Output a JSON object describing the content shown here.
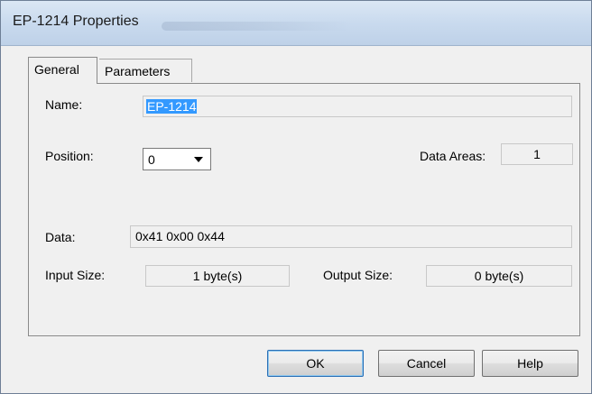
{
  "window": {
    "title": "EP-1214 Properties"
  },
  "tabs": [
    {
      "label": "General",
      "active": true
    },
    {
      "label": "Parameters",
      "active": false
    }
  ],
  "general": {
    "name_label": "Name:",
    "name_value": "EP-1214",
    "position_label": "Position:",
    "position_value": "0",
    "data_areas_label": "Data Areas:",
    "data_areas_value": "1",
    "data_label": "Data:",
    "data_value": "0x41 0x00 0x44",
    "input_size_label": "Input Size:",
    "input_size_value": "1 byte(s)",
    "output_size_label": "Output Size:",
    "output_size_value": "0 byte(s)"
  },
  "buttons": {
    "ok": "OK",
    "cancel": "Cancel",
    "help": "Help"
  },
  "icons": {
    "dropdown": "chevron-down-icon"
  },
  "colors": {
    "selection": "#3399ff",
    "titlebar": "#c9daee"
  }
}
